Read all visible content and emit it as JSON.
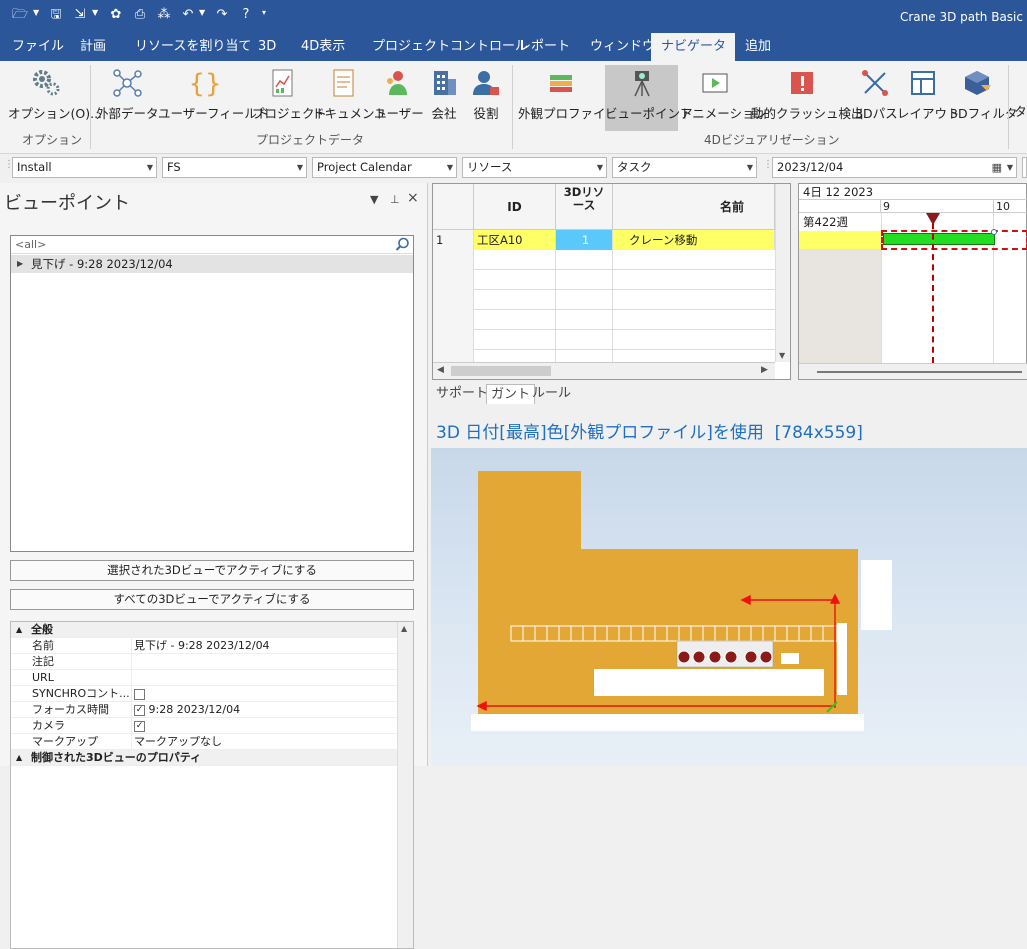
{
  "app": {
    "title": "Crane 3D path Basic"
  },
  "qat": {
    "icons": [
      "folder-open-icon",
      "save-icon",
      "import-icon",
      "puzzle-icon",
      "print-icon",
      "network-icon",
      "undo-icon",
      "redo-icon",
      "help-icon"
    ]
  },
  "tabs": [
    "ファイル",
    "計画",
    "リソースを割り当て",
    "3D",
    "4D表示",
    "プロジェクトコントロール",
    "レポート",
    "ウィンドウ",
    "ナビゲータ",
    "追加"
  ],
  "active_tab": "ナビゲータ",
  "ribbon": {
    "buttons": [
      "オプション(O)...",
      "外部データ",
      "ユーザーフィールド",
      "プロジェクト",
      "ドキュメント",
      "ユーザー",
      "会社",
      "役割",
      "外観プロファイル",
      "ビューポイント",
      "アニメーション",
      "動的クラッシュ検出",
      "3Dパス",
      "レイアウト",
      "3Dフィルタ",
      "タ"
    ],
    "selected": "ビューポイント",
    "groups": [
      "オプション",
      "プロジェクトデータ",
      "4Dビジュアリゼーション"
    ]
  },
  "filters": {
    "f1": "Install",
    "f2": "FS",
    "f3": "Project Calendar",
    "f4": "リソース",
    "f5": "タスク",
    "date": "2023/12/04"
  },
  "panel": {
    "title": "ビューポイント",
    "search_placeholder": "<all>",
    "item": "見下げ - 9:28 2023/12/04",
    "btn_selected": "選択された3Dビューでアクティブにする",
    "btn_all": "すべての3Dビューでアクティブにする"
  },
  "props": {
    "cat1": "全般",
    "rows": [
      {
        "k": "名前",
        "v": "見下げ - 9:28 2023/12/04"
      },
      {
        "k": "注記",
        "v": ""
      },
      {
        "k": "URL",
        "v": ""
      },
      {
        "k": "SYNCHROコント...",
        "v": ""
      },
      {
        "k": "フォーカス時間",
        "v": "9:28 2023/12/04"
      },
      {
        "k": "カメラ",
        "v": ""
      },
      {
        "k": "マークアップ",
        "v": "マークアップなし"
      }
    ],
    "cat2": "制御された3Dビューのプロパティ"
  },
  "grid": {
    "headers": [
      "ID",
      "3Dリソース",
      "名前"
    ],
    "row": {
      "num": "1",
      "id": "工区A10",
      "res": "1",
      "name": "クレーン移動"
    }
  },
  "gantt": {
    "month": "4日 12 2023",
    "d1": "9",
    "d2": "10",
    "week": "第422週"
  },
  "bottom_tabs": [
    "サポート",
    "ガント",
    "ルール"
  ],
  "active_bottom_tab": "ガント",
  "view": {
    "title": "3D 日付[最高]色[外観プロファイル]を使用",
    "size": "[784x559]"
  },
  "colors": {
    "accent": "#2b579a",
    "building": "#e3a735",
    "task_bar": "#22dd22",
    "row_highlight": "#ffff66"
  }
}
